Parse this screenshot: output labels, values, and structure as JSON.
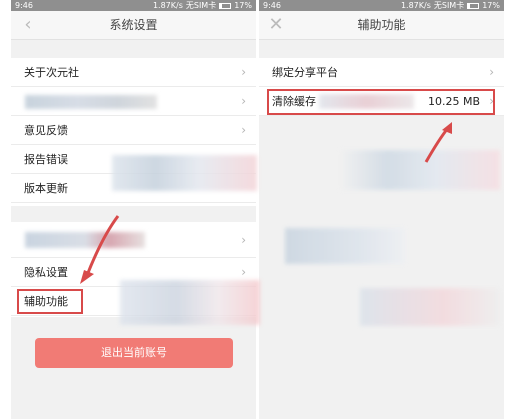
{
  "status_bar": {
    "time": "9:46",
    "speed": "1.87K/s",
    "right_speed": "1.87K/s",
    "sim": "无SIM卡",
    "battery": "17%"
  },
  "left_screen": {
    "title": "系统设置",
    "items": [
      {
        "label": "关于次元社"
      },
      {
        "label": ""
      },
      {
        "label": "意见反馈"
      },
      {
        "label": "报告错误"
      },
      {
        "label": "版本更新"
      },
      {
        "label": ""
      },
      {
        "label": "隐私设置"
      },
      {
        "label": "辅助功能"
      }
    ],
    "logout_label": "退出当前账号"
  },
  "right_screen": {
    "title": "辅助功能",
    "items": [
      {
        "label": "绑定分享平台"
      },
      {
        "label": "清除缓存",
        "value": "10.25 MB"
      }
    ]
  },
  "colors": {
    "highlight": "#d84a4a",
    "logout": "#f17b75"
  }
}
